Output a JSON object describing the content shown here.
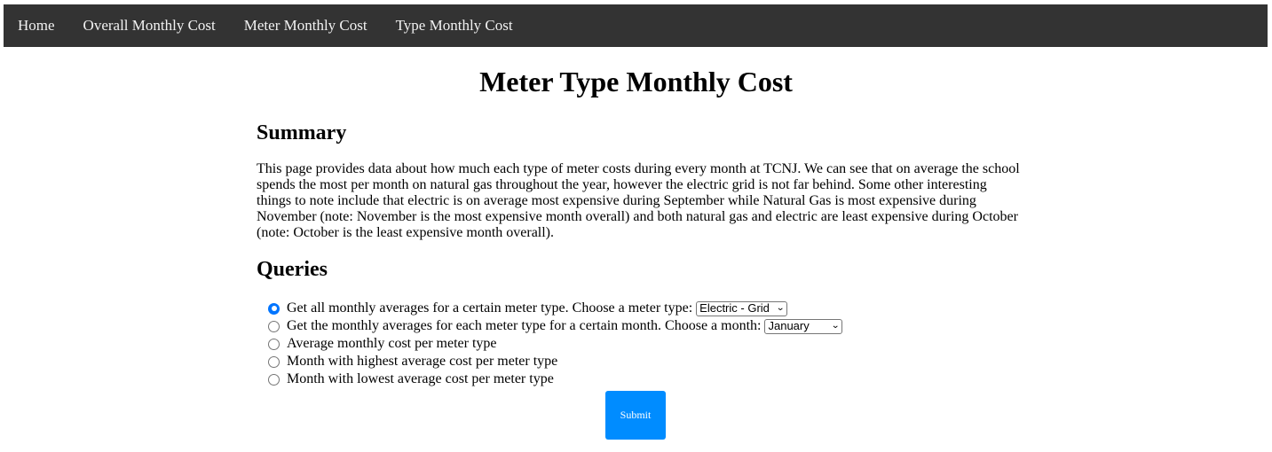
{
  "nav": {
    "items": [
      {
        "label": "Home"
      },
      {
        "label": "Overall Monthly Cost"
      },
      {
        "label": "Meter Monthly Cost"
      },
      {
        "label": "Type Monthly Cost"
      }
    ]
  },
  "page": {
    "title": "Meter Type Monthly Cost"
  },
  "summary": {
    "heading": "Summary",
    "text": "This page provides data about how much each type of meter costs during every month at TCNJ. We can see that on average the school spends the most per month on natural gas throughout the year, however the electric grid is not far behind. Some other interesting things to note include that electric is on average most expensive during September while Natural Gas is most expensive during November (note: November is the most expensive month overall) and both natural gas and electric are least expensive during October (note: October is the least expensive month overall)."
  },
  "queries": {
    "heading": "Queries",
    "options": [
      {
        "label": "Get all monthly averages for a certain meter type. Choose a meter type:",
        "checked": true,
        "select_value": "Electric - Grid"
      },
      {
        "label": "Get the monthly averages for each meter type for a certain month. Choose a month:",
        "checked": false,
        "select_value": "January"
      },
      {
        "label": "Average monthly cost per meter type",
        "checked": false
      },
      {
        "label": "Month with highest average cost per meter type",
        "checked": false
      },
      {
        "label": "Month with lowest average cost per meter type",
        "checked": false
      }
    ],
    "submit_label": "Submit"
  },
  "colors": {
    "navbar_bg": "#333333",
    "nav_text": "#f2f2f2",
    "accent": "#008cff",
    "radio_checked": "#0075ff"
  }
}
